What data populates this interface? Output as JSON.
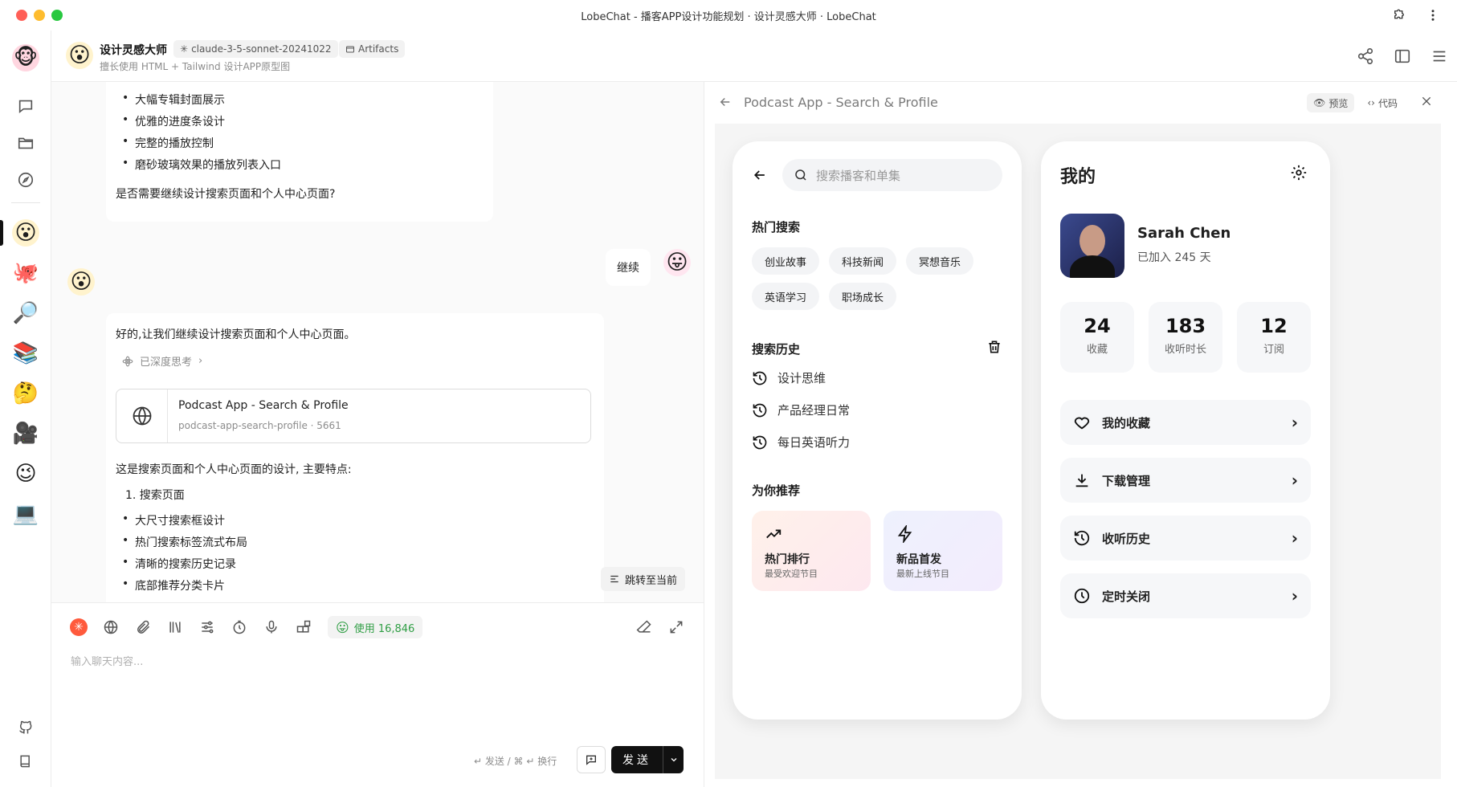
{
  "window": {
    "title": "LobeChat - 播客APP设计功能规划 · 设计灵感大师 · LobeChat"
  },
  "colors": {
    "accent": "#ff5a3c",
    "brand_dark": "#111111",
    "usage_green": "#2f9e44"
  },
  "sidebar": {
    "nav_icons": [
      "chat-icon",
      "folder-icon",
      "compass-icon"
    ],
    "footer_icons": [
      "github-icon",
      "book-icon"
    ]
  },
  "header": {
    "title": "设计灵感大师",
    "model_tag": "claude-3-5-sonnet-20241022",
    "artifacts_tag": "Artifacts",
    "subtitle": "擅长使用 HTML + Tailwind 设计APP原型图"
  },
  "chat": {
    "prev_message_list": [
      "大幅专辑封面展示",
      "优雅的进度条设计",
      "完整的播放控制",
      "磨砂玻璃效果的播放列表入口"
    ],
    "prev_message_question": "是否需要继续设计搜索页面和个人中心页面?",
    "user_message": "继续",
    "reply_intro": "好的,让我们继续设计搜索页面和个人中心页面。",
    "thinking_label": "已深度思考",
    "artifact_title": "Podcast App - Search & Profile",
    "artifact_meta": "podcast-app-search-profile · 5661",
    "reply_summary": "这是搜索页面和个人中心页面的设计, 主要特点:",
    "section_1": "1. 搜索页面",
    "section_1_list": [
      "大尺寸搜索框设计",
      "热门搜索标签流式布局",
      "清晰的搜索历史记录",
      "底部推荐分类卡片"
    ],
    "jump_label": "跳转至当前"
  },
  "input": {
    "usage_label": "使用 16,846",
    "placeholder": "输入聊天内容...",
    "hint": "↵ 发送 / ⌘ ↵ 换行",
    "send_label": "发送"
  },
  "panel": {
    "title": "Podcast App - Search & Profile",
    "preview_tab": "预览",
    "code_tab": "代码"
  },
  "search_screen": {
    "search_placeholder": "搜索播客和单集",
    "hot_title": "热门搜索",
    "hot_tags": [
      "创业故事",
      "科技新闻",
      "冥想音乐",
      "英语学习",
      "职场成长"
    ],
    "history_title": "搜索历史",
    "history_items": [
      "设计思维",
      "产品经理日常",
      "每日英语听力"
    ],
    "recommend_title": "为你推荐",
    "recommend_cards": [
      {
        "title": "热门排行",
        "subtitle": "最受欢迎节目"
      },
      {
        "title": "新品首发",
        "subtitle": "最新上线节目"
      }
    ]
  },
  "profile_screen": {
    "title": "我的",
    "name": "Sarah Chen",
    "joined": "已加入 245 天",
    "stats": [
      {
        "value": "24",
        "label": "收藏"
      },
      {
        "value": "183",
        "label": "收听时长"
      },
      {
        "value": "12",
        "label": "订阅"
      }
    ],
    "menu": [
      "我的收藏",
      "下载管理",
      "收听历史",
      "定时关闭"
    ]
  }
}
